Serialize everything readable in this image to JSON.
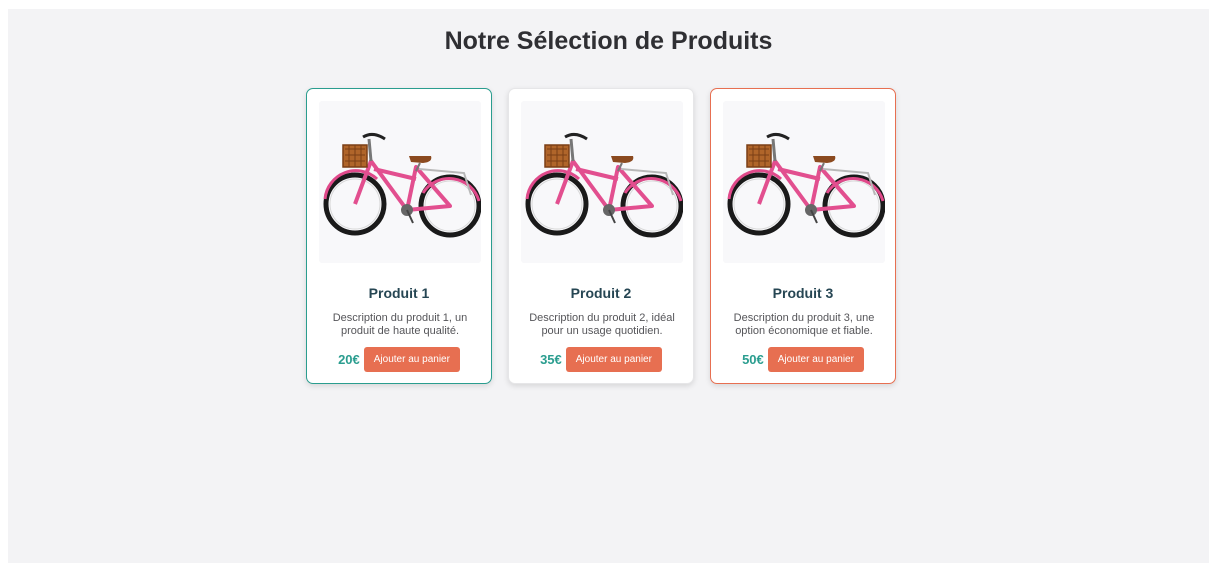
{
  "page": {
    "title": "Notre Sélection de Produits"
  },
  "products": [
    {
      "name": "Produit 1",
      "description": "Description du produit 1, un produit de haute qualité.",
      "price": "20€",
      "button_label": "Ajouter au panier",
      "image_alt": "pink-bicycle-with-basket"
    },
    {
      "name": "Produit 2",
      "description": "Description du produit 2, idéal pour un usage quotidien.",
      "price": "35€",
      "button_label": "Ajouter au panier",
      "image_alt": "pink-bicycle-with-basket"
    },
    {
      "name": "Produit 3",
      "description": "Description du produit 3, une option économique et fiable.",
      "price": "50€",
      "button_label": "Ajouter au panier",
      "image_alt": "pink-bicycle-with-basket"
    }
  ],
  "colors": {
    "teal_accent": "#2a9d8f",
    "orange_accent": "#e76f51",
    "title_text": "#264653",
    "background": "#f3f3f5"
  }
}
